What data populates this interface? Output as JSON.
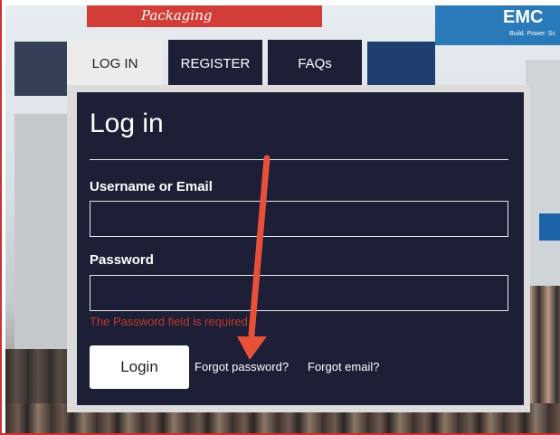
{
  "background": {
    "banner_red_text": "Packaging",
    "banner_blue_title": "EMC",
    "banner_blue_sub": "Build. Power. Sc"
  },
  "tabs": [
    {
      "label": "LOG IN",
      "active": true
    },
    {
      "label": "REGISTER",
      "active": false
    },
    {
      "label": "FAQs",
      "active": false
    }
  ],
  "form": {
    "title": "Log in",
    "username_label": "Username or Email",
    "username_value": "",
    "password_label": "Password",
    "password_value": "",
    "password_error": "The Password field is required.",
    "login_button": "Login",
    "forgot_password": "Forgot password?",
    "forgot_email": "Forgot email?"
  },
  "colors": {
    "panel": "#1c1f36",
    "error": "#c0392b",
    "annotation_arrow": "#e8503a"
  }
}
